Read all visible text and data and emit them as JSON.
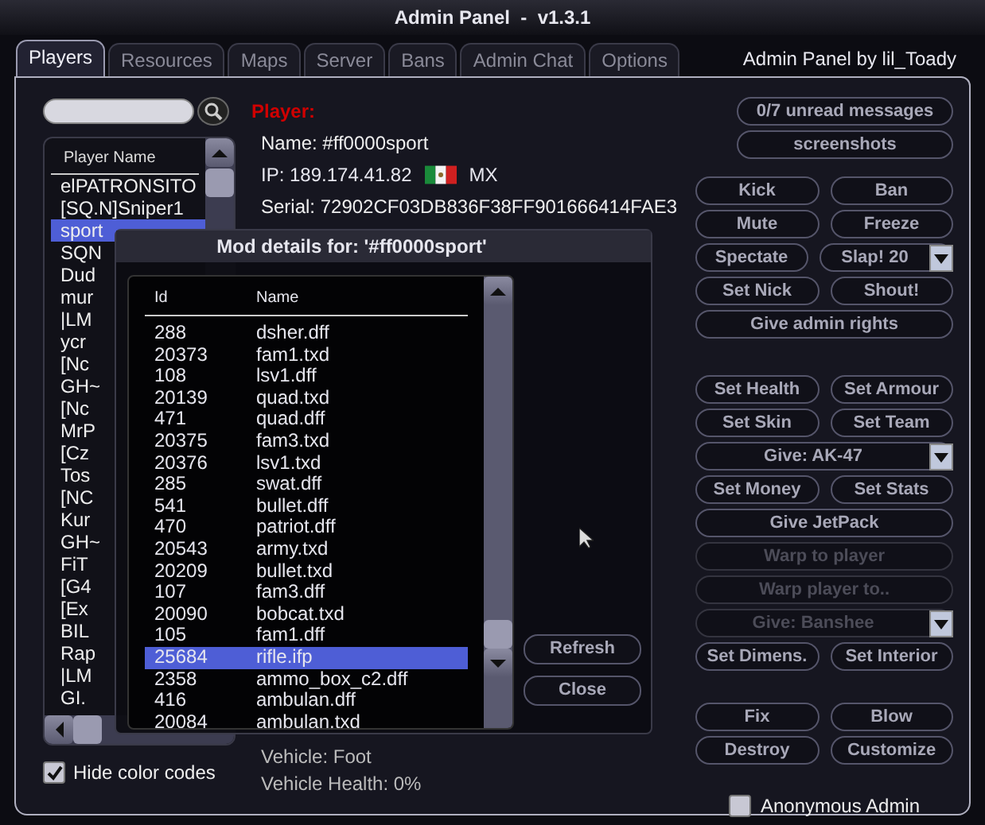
{
  "window": {
    "title": "Admin Panel  -  v1.3.1"
  },
  "tabs": [
    {
      "label": "Players",
      "selected": true
    },
    {
      "label": "Resources",
      "selected": false
    },
    {
      "label": "Maps",
      "selected": false
    },
    {
      "label": "Server",
      "selected": false
    },
    {
      "label": "Bans",
      "selected": false
    },
    {
      "label": "Admin Chat",
      "selected": false
    },
    {
      "label": "Options",
      "selected": false
    }
  ],
  "credit": "Admin Panel by lil_Toady",
  "players": {
    "column": "Player Name",
    "items": [
      {
        "name": "elPATRONSITO",
        "selected": false
      },
      {
        "name": "[SQ.N]Sniper1",
        "selected": false
      },
      {
        "name": "sport",
        "selected": true
      },
      {
        "name": "SQN",
        "selected": false
      },
      {
        "name": "Dud",
        "selected": false
      },
      {
        "name": "mur",
        "selected": false
      },
      {
        "name": "|LM",
        "selected": false
      },
      {
        "name": "ycr",
        "selected": false
      },
      {
        "name": "[Nc",
        "selected": false
      },
      {
        "name": "GH~",
        "selected": false
      },
      {
        "name": "[Nc",
        "selected": false
      },
      {
        "name": "MrP",
        "selected": false
      },
      {
        "name": "[Cz",
        "selected": false
      },
      {
        "name": "Tos",
        "selected": false
      },
      {
        "name": "[NC",
        "selected": false
      },
      {
        "name": "Kur",
        "selected": false
      },
      {
        "name": "GH~",
        "selected": false
      },
      {
        "name": "FiT",
        "selected": false
      },
      {
        "name": "[G4",
        "selected": false
      },
      {
        "name": "[Ex",
        "selected": false
      },
      {
        "name": "BIL",
        "selected": false
      },
      {
        "name": "Rap",
        "selected": false
      },
      {
        "name": "|LM",
        "selected": false
      },
      {
        "name": "GI.",
        "selected": false
      }
    ],
    "hide_color_codes": {
      "label": "Hide color codes",
      "checked": true
    }
  },
  "player_info": {
    "heading": "Player:",
    "name": "Name:  #ff0000sport",
    "ip": "IP: 189.174.41.82",
    "country": "MX",
    "serial": "Serial: 72902CF03DB836F38FF901666414FAE3",
    "vehicle": "Vehicle: Foot",
    "vehicle_health": "Vehicle Health: 0%"
  },
  "actions": [
    [
      [
        {
          "kind": "button",
          "label": "0/7 unread messages",
          "disabled": false
        }
      ],
      [
        {
          "kind": "button",
          "label": "screenshots",
          "disabled": false
        }
      ]
    ],
    [
      [
        {
          "kind": "button",
          "label": "Kick",
          "disabled": false
        },
        {
          "kind": "button",
          "label": "Ban",
          "disabled": false
        }
      ],
      [
        {
          "kind": "button",
          "label": "Mute",
          "disabled": false
        },
        {
          "kind": "button",
          "label": "Freeze",
          "disabled": false
        }
      ],
      [
        {
          "kind": "button",
          "label": "Spectate",
          "disabled": false
        },
        {
          "kind": "dropdown",
          "label": "Slap! 20",
          "disabled": false
        }
      ],
      [
        {
          "kind": "button",
          "label": "Set Nick",
          "disabled": false
        },
        {
          "kind": "button",
          "label": "Shout!",
          "disabled": false
        }
      ],
      [
        {
          "kind": "button",
          "label": "Give admin rights",
          "disabled": false
        }
      ]
    ],
    [
      [
        {
          "kind": "button",
          "label": "Set Health",
          "disabled": false
        },
        {
          "kind": "button",
          "label": "Set Armour",
          "disabled": false
        }
      ],
      [
        {
          "kind": "button",
          "label": "Set Skin",
          "disabled": false
        },
        {
          "kind": "button",
          "label": "Set Team",
          "disabled": false
        }
      ],
      [
        {
          "kind": "dropdown",
          "label": "Give: AK-47",
          "disabled": false
        }
      ],
      [
        {
          "kind": "button",
          "label": "Set Money",
          "disabled": false
        },
        {
          "kind": "button",
          "label": "Set Stats",
          "disabled": false
        }
      ],
      [
        {
          "kind": "button",
          "label": "Give JetPack",
          "disabled": false
        }
      ],
      [
        {
          "kind": "button",
          "label": "Warp to player",
          "disabled": true
        }
      ],
      [
        {
          "kind": "button",
          "label": "Warp player to..",
          "disabled": true
        }
      ],
      [
        {
          "kind": "dropdown",
          "label": "Give: Banshee",
          "disabled": true
        }
      ],
      [
        {
          "kind": "button",
          "label": "Set Dimens.",
          "disabled": false
        },
        {
          "kind": "button",
          "label": "Set Interior",
          "disabled": false
        }
      ]
    ],
    [
      [
        {
          "kind": "button",
          "label": "Fix",
          "disabled": false
        },
        {
          "kind": "button",
          "label": "Blow",
          "disabled": false
        }
      ],
      [
        {
          "kind": "button",
          "label": "Destroy",
          "disabled": false
        },
        {
          "kind": "button",
          "label": "Customize",
          "disabled": false
        }
      ]
    ]
  ],
  "anonymous_admin": {
    "label": "Anonymous Admin",
    "checked": false
  },
  "mod_dialog": {
    "title": "Mod details for: '#ff0000sport'",
    "columns": [
      "Id",
      "Name"
    ],
    "rows": [
      {
        "id": "288",
        "name": "dsher.dff",
        "selected": false
      },
      {
        "id": "20373",
        "name": "fam1.txd",
        "selected": false
      },
      {
        "id": "108",
        "name": "lsv1.dff",
        "selected": false
      },
      {
        "id": "20139",
        "name": "quad.txd",
        "selected": false
      },
      {
        "id": "471",
        "name": "quad.dff",
        "selected": false
      },
      {
        "id": "20375",
        "name": "fam3.txd",
        "selected": false
      },
      {
        "id": "20376",
        "name": "lsv1.txd",
        "selected": false
      },
      {
        "id": "285",
        "name": "swat.dff",
        "selected": false
      },
      {
        "id": "541",
        "name": "bullet.dff",
        "selected": false
      },
      {
        "id": "470",
        "name": "patriot.dff",
        "selected": false
      },
      {
        "id": "20543",
        "name": "army.txd",
        "selected": false
      },
      {
        "id": "20209",
        "name": "bullet.txd",
        "selected": false
      },
      {
        "id": "107",
        "name": "fam3.dff",
        "selected": false
      },
      {
        "id": "20090",
        "name": "bobcat.txd",
        "selected": false
      },
      {
        "id": "105",
        "name": "fam1.dff",
        "selected": false
      },
      {
        "id": "25684",
        "name": "rifle.ifp",
        "selected": true
      },
      {
        "id": "2358",
        "name": "ammo_box_c2.dff",
        "selected": false
      },
      {
        "id": "416",
        "name": "ambulan.dff",
        "selected": false
      },
      {
        "id": "20084",
        "name": "ambulan.txd",
        "selected": false
      }
    ],
    "buttons": [
      "Refresh",
      "Close"
    ]
  }
}
